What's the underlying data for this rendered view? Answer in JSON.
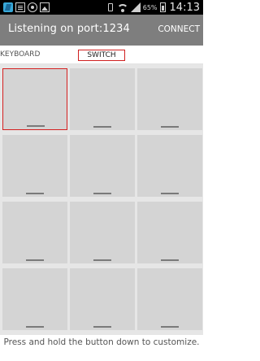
{
  "status_bar": {
    "left_icons": [
      "app-icon",
      "document-icon",
      "circle-icon",
      "image-icon"
    ],
    "battery_text": "65%",
    "time": "14:13"
  },
  "action_bar": {
    "title": "Listening on port:1234",
    "connect_label": "CONNECT"
  },
  "tabs": {
    "keyboard_label": "KEYBOARD",
    "switch_label": "SWITCH",
    "active": "SWITCH"
  },
  "grid": {
    "rows": 4,
    "columns": 3,
    "selected_index": 0
  },
  "hint_text": "Press and hold the button down to customize.",
  "colors": {
    "action_bar": "#7e7e7e",
    "cell": "#d4d4d4",
    "selection": "#d42020"
  }
}
